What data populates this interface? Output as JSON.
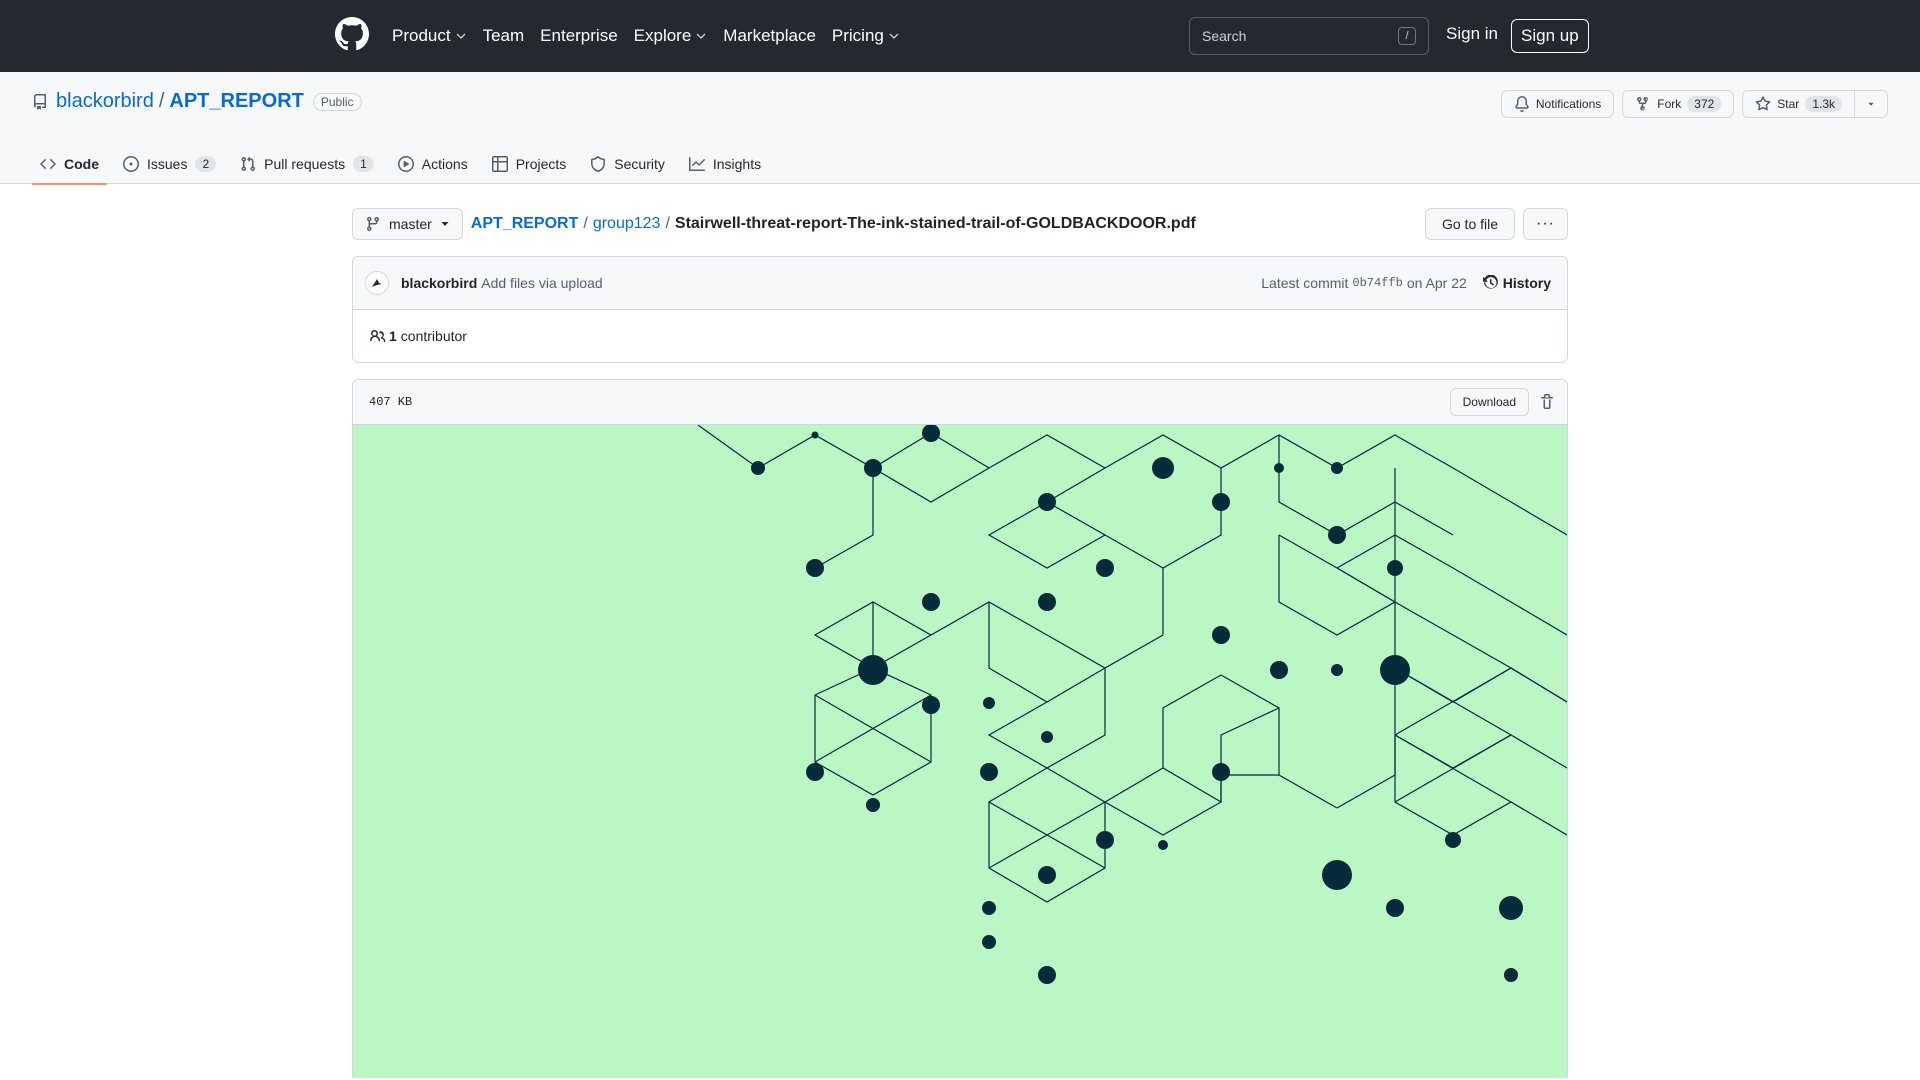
{
  "header": {
    "nav": [
      {
        "label": "Product",
        "dropdown": true
      },
      {
        "label": "Team",
        "dropdown": false
      },
      {
        "label": "Enterprise",
        "dropdown": false
      },
      {
        "label": "Explore",
        "dropdown": true
      },
      {
        "label": "Marketplace",
        "dropdown": false
      },
      {
        "label": "Pricing",
        "dropdown": true
      }
    ],
    "search_placeholder": "Search",
    "search_shortcut": "/",
    "sign_in": "Sign in",
    "sign_up": "Sign up"
  },
  "repo": {
    "owner": "blackorbird",
    "name": "APT_REPORT",
    "visibility": "Public",
    "notifications_label": "Notifications",
    "fork_label": "Fork",
    "fork_count": "372",
    "star_label": "Star",
    "star_count": "1.3k"
  },
  "tabs": [
    {
      "label": "Code",
      "icon": "code-icon",
      "active": true,
      "count": ""
    },
    {
      "label": "Issues",
      "icon": "issue-icon",
      "active": false,
      "count": "2"
    },
    {
      "label": "Pull requests",
      "icon": "pull-request-icon",
      "active": false,
      "count": "1"
    },
    {
      "label": "Actions",
      "icon": "play-icon",
      "active": false,
      "count": ""
    },
    {
      "label": "Projects",
      "icon": "table-icon",
      "active": false,
      "count": ""
    },
    {
      "label": "Security",
      "icon": "shield-icon",
      "active": false,
      "count": ""
    },
    {
      "label": "Insights",
      "icon": "graph-icon",
      "active": false,
      "count": ""
    }
  ],
  "file": {
    "branch": "master",
    "crumb_repo": "APT_REPORT",
    "crumb_dir": "group123",
    "filename": "Stairwell-threat-report-The-ink-stained-trail-of-GOLDBACKDOOR.pdf",
    "go_to_file": "Go to file",
    "more": "···",
    "size": "407 KB",
    "download": "Download"
  },
  "commit": {
    "author": "blackorbird",
    "message": "Add files via upload",
    "latest_label": "Latest commit",
    "sha": "0b74ffb",
    "date": "on Apr 22",
    "history": "History",
    "contributors_count": "1",
    "contributors_label": "contributor"
  },
  "colors": {
    "header_bg": "#24292f",
    "link": "#0969da",
    "active_tab_underline": "#fd8c73",
    "pdf_bg": "#baf7c5",
    "pdf_node": "#052a3a"
  }
}
